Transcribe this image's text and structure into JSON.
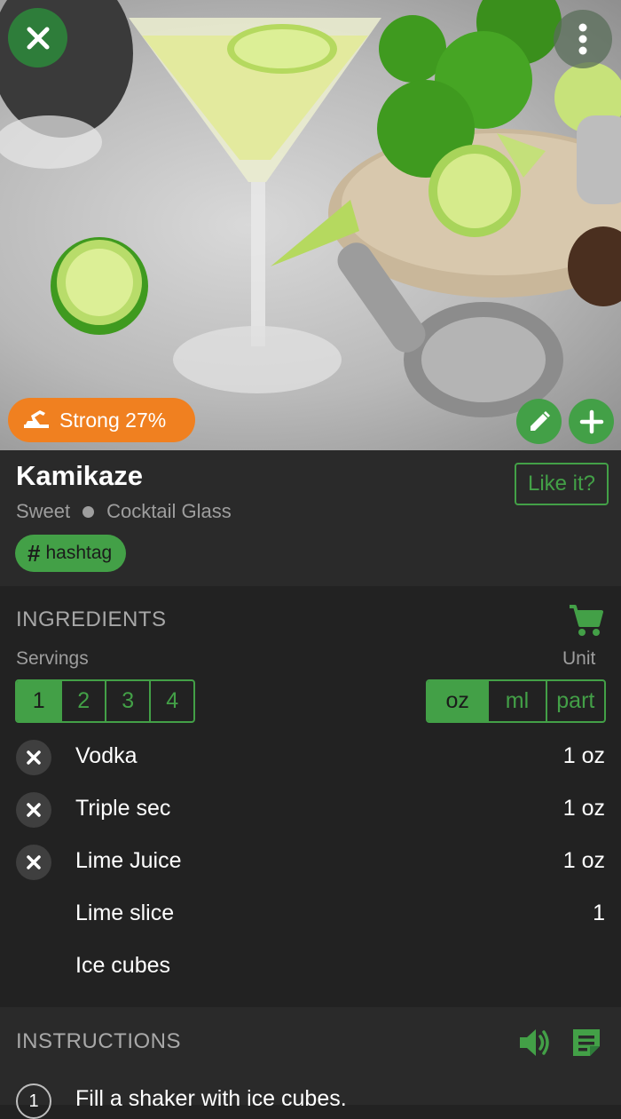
{
  "hero": {
    "strength_label": "Strong 27%",
    "icons": {
      "close": "close-icon",
      "menu": "more-vertical-icon",
      "edit": "pencil-icon",
      "add": "plus-icon",
      "strength": "strength-icon"
    }
  },
  "drink": {
    "name": "Kamikaze",
    "taste": "Sweet",
    "glass": "Cocktail Glass",
    "hashtag": "hashtag",
    "like_label": "Like it?"
  },
  "ingredients": {
    "heading": "INGREDIENTS",
    "servings_label": "Servings",
    "unit_label": "Unit",
    "servings_options": [
      "1",
      "2",
      "3",
      "4"
    ],
    "selected_serving": "1",
    "unit_options": [
      "oz",
      "ml",
      "part"
    ],
    "selected_unit": "oz",
    "items": [
      {
        "name": "Vodka",
        "amount": "1 oz",
        "removable": true
      },
      {
        "name": "Triple sec",
        "amount": "1 oz",
        "removable": true
      },
      {
        "name": "Lime Juice",
        "amount": "1 oz",
        "removable": true
      },
      {
        "name": "Lime slice",
        "amount": "1",
        "removable": false
      },
      {
        "name": "Ice cubes",
        "amount": "",
        "removable": false
      }
    ]
  },
  "instructions": {
    "heading": "INSTRUCTIONS",
    "steps": [
      {
        "number": "1",
        "text": "Fill a shaker with ice cubes."
      }
    ]
  },
  "colors": {
    "accent": "#43a047",
    "strength_badge": "#f08020",
    "background": "#222222",
    "card": "#2a2a2a"
  }
}
